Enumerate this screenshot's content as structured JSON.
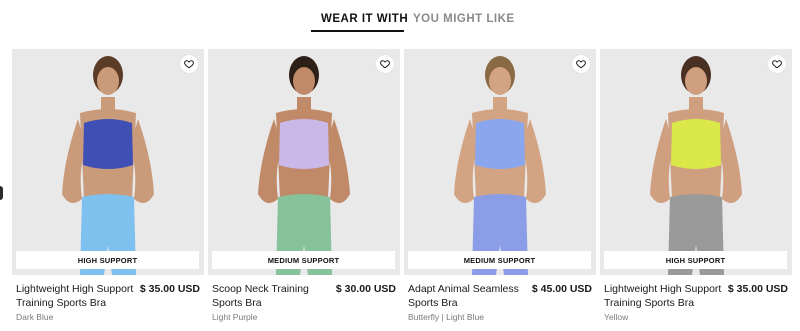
{
  "tabs": [
    {
      "label": "WEAR IT WITH",
      "active": true
    },
    {
      "label": "YOU MIGHT LIKE",
      "active": false
    }
  ],
  "products": [
    {
      "badge": "HIGH SUPPORT",
      "title": "Lightweight High Support Training Sports Bra",
      "price": "$ 35.00 USD",
      "color": "Dark Blue",
      "top_color": "#3f4fb4",
      "bottom_color": "#7fc1ee",
      "skin": "#c99b7a",
      "hair": "#5a3b26"
    },
    {
      "badge": "MEDIUM SUPPORT",
      "title": "Scoop Neck Training Sports Bra",
      "price": "$ 30.00 USD",
      "color": "Light Purple",
      "top_color": "#c9b8e8",
      "bottom_color": "#86c39a",
      "skin": "#c08a68",
      "hair": "#2e1f17"
    },
    {
      "badge": "MEDIUM SUPPORT",
      "title": "Adapt Animal Seamless Sports Bra",
      "price": "$ 45.00 USD",
      "color": "Butterfly | Light Blue",
      "top_color": "#8aa6ef",
      "bottom_color": "#8c9de8",
      "skin": "#d2a483",
      "hair": "#8a6a44"
    },
    {
      "badge": "HIGH SUPPORT",
      "title": "Lightweight High Support Training Sports Bra",
      "price": "$ 35.00 USD",
      "color": "Yellow",
      "top_color": "#dbe84a",
      "bottom_color": "#9a9a9a",
      "skin": "#cf9f80",
      "hair": "#4a3022"
    }
  ],
  "icons": {
    "wishlist": "heart-outline-icon"
  }
}
